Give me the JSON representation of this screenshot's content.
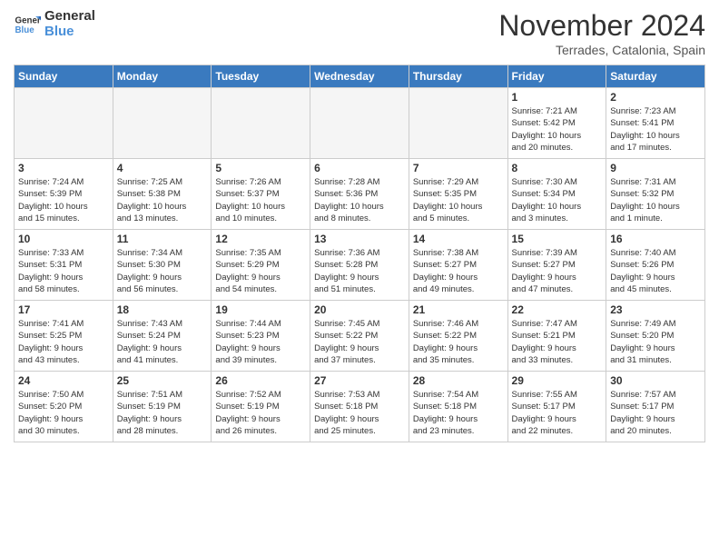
{
  "logo": {
    "line1": "General",
    "line2": "Blue"
  },
  "title": "November 2024",
  "subtitle": "Terrades, Catalonia, Spain",
  "days_of_week": [
    "Sunday",
    "Monday",
    "Tuesday",
    "Wednesday",
    "Thursday",
    "Friday",
    "Saturday"
  ],
  "weeks": [
    [
      {
        "num": "",
        "info": "",
        "empty": true
      },
      {
        "num": "",
        "info": "",
        "empty": true
      },
      {
        "num": "",
        "info": "",
        "empty": true
      },
      {
        "num": "",
        "info": "",
        "empty": true
      },
      {
        "num": "",
        "info": "",
        "empty": true
      },
      {
        "num": "1",
        "info": "Sunrise: 7:21 AM\nSunset: 5:42 PM\nDaylight: 10 hours\nand 20 minutes.",
        "empty": false
      },
      {
        "num": "2",
        "info": "Sunrise: 7:23 AM\nSunset: 5:41 PM\nDaylight: 10 hours\nand 17 minutes.",
        "empty": false
      }
    ],
    [
      {
        "num": "3",
        "info": "Sunrise: 7:24 AM\nSunset: 5:39 PM\nDaylight: 10 hours\nand 15 minutes.",
        "empty": false
      },
      {
        "num": "4",
        "info": "Sunrise: 7:25 AM\nSunset: 5:38 PM\nDaylight: 10 hours\nand 13 minutes.",
        "empty": false
      },
      {
        "num": "5",
        "info": "Sunrise: 7:26 AM\nSunset: 5:37 PM\nDaylight: 10 hours\nand 10 minutes.",
        "empty": false
      },
      {
        "num": "6",
        "info": "Sunrise: 7:28 AM\nSunset: 5:36 PM\nDaylight: 10 hours\nand 8 minutes.",
        "empty": false
      },
      {
        "num": "7",
        "info": "Sunrise: 7:29 AM\nSunset: 5:35 PM\nDaylight: 10 hours\nand 5 minutes.",
        "empty": false
      },
      {
        "num": "8",
        "info": "Sunrise: 7:30 AM\nSunset: 5:34 PM\nDaylight: 10 hours\nand 3 minutes.",
        "empty": false
      },
      {
        "num": "9",
        "info": "Sunrise: 7:31 AM\nSunset: 5:32 PM\nDaylight: 10 hours\nand 1 minute.",
        "empty": false
      }
    ],
    [
      {
        "num": "10",
        "info": "Sunrise: 7:33 AM\nSunset: 5:31 PM\nDaylight: 9 hours\nand 58 minutes.",
        "empty": false
      },
      {
        "num": "11",
        "info": "Sunrise: 7:34 AM\nSunset: 5:30 PM\nDaylight: 9 hours\nand 56 minutes.",
        "empty": false
      },
      {
        "num": "12",
        "info": "Sunrise: 7:35 AM\nSunset: 5:29 PM\nDaylight: 9 hours\nand 54 minutes.",
        "empty": false
      },
      {
        "num": "13",
        "info": "Sunrise: 7:36 AM\nSunset: 5:28 PM\nDaylight: 9 hours\nand 51 minutes.",
        "empty": false
      },
      {
        "num": "14",
        "info": "Sunrise: 7:38 AM\nSunset: 5:27 PM\nDaylight: 9 hours\nand 49 minutes.",
        "empty": false
      },
      {
        "num": "15",
        "info": "Sunrise: 7:39 AM\nSunset: 5:27 PM\nDaylight: 9 hours\nand 47 minutes.",
        "empty": false
      },
      {
        "num": "16",
        "info": "Sunrise: 7:40 AM\nSunset: 5:26 PM\nDaylight: 9 hours\nand 45 minutes.",
        "empty": false
      }
    ],
    [
      {
        "num": "17",
        "info": "Sunrise: 7:41 AM\nSunset: 5:25 PM\nDaylight: 9 hours\nand 43 minutes.",
        "empty": false
      },
      {
        "num": "18",
        "info": "Sunrise: 7:43 AM\nSunset: 5:24 PM\nDaylight: 9 hours\nand 41 minutes.",
        "empty": false
      },
      {
        "num": "19",
        "info": "Sunrise: 7:44 AM\nSunset: 5:23 PM\nDaylight: 9 hours\nand 39 minutes.",
        "empty": false
      },
      {
        "num": "20",
        "info": "Sunrise: 7:45 AM\nSunset: 5:22 PM\nDaylight: 9 hours\nand 37 minutes.",
        "empty": false
      },
      {
        "num": "21",
        "info": "Sunrise: 7:46 AM\nSunset: 5:22 PM\nDaylight: 9 hours\nand 35 minutes.",
        "empty": false
      },
      {
        "num": "22",
        "info": "Sunrise: 7:47 AM\nSunset: 5:21 PM\nDaylight: 9 hours\nand 33 minutes.",
        "empty": false
      },
      {
        "num": "23",
        "info": "Sunrise: 7:49 AM\nSunset: 5:20 PM\nDaylight: 9 hours\nand 31 minutes.",
        "empty": false
      }
    ],
    [
      {
        "num": "24",
        "info": "Sunrise: 7:50 AM\nSunset: 5:20 PM\nDaylight: 9 hours\nand 30 minutes.",
        "empty": false
      },
      {
        "num": "25",
        "info": "Sunrise: 7:51 AM\nSunset: 5:19 PM\nDaylight: 9 hours\nand 28 minutes.",
        "empty": false
      },
      {
        "num": "26",
        "info": "Sunrise: 7:52 AM\nSunset: 5:19 PM\nDaylight: 9 hours\nand 26 minutes.",
        "empty": false
      },
      {
        "num": "27",
        "info": "Sunrise: 7:53 AM\nSunset: 5:18 PM\nDaylight: 9 hours\nand 25 minutes.",
        "empty": false
      },
      {
        "num": "28",
        "info": "Sunrise: 7:54 AM\nSunset: 5:18 PM\nDaylight: 9 hours\nand 23 minutes.",
        "empty": false
      },
      {
        "num": "29",
        "info": "Sunrise: 7:55 AM\nSunset: 5:17 PM\nDaylight: 9 hours\nand 22 minutes.",
        "empty": false
      },
      {
        "num": "30",
        "info": "Sunrise: 7:57 AM\nSunset: 5:17 PM\nDaylight: 9 hours\nand 20 minutes.",
        "empty": false
      }
    ]
  ]
}
